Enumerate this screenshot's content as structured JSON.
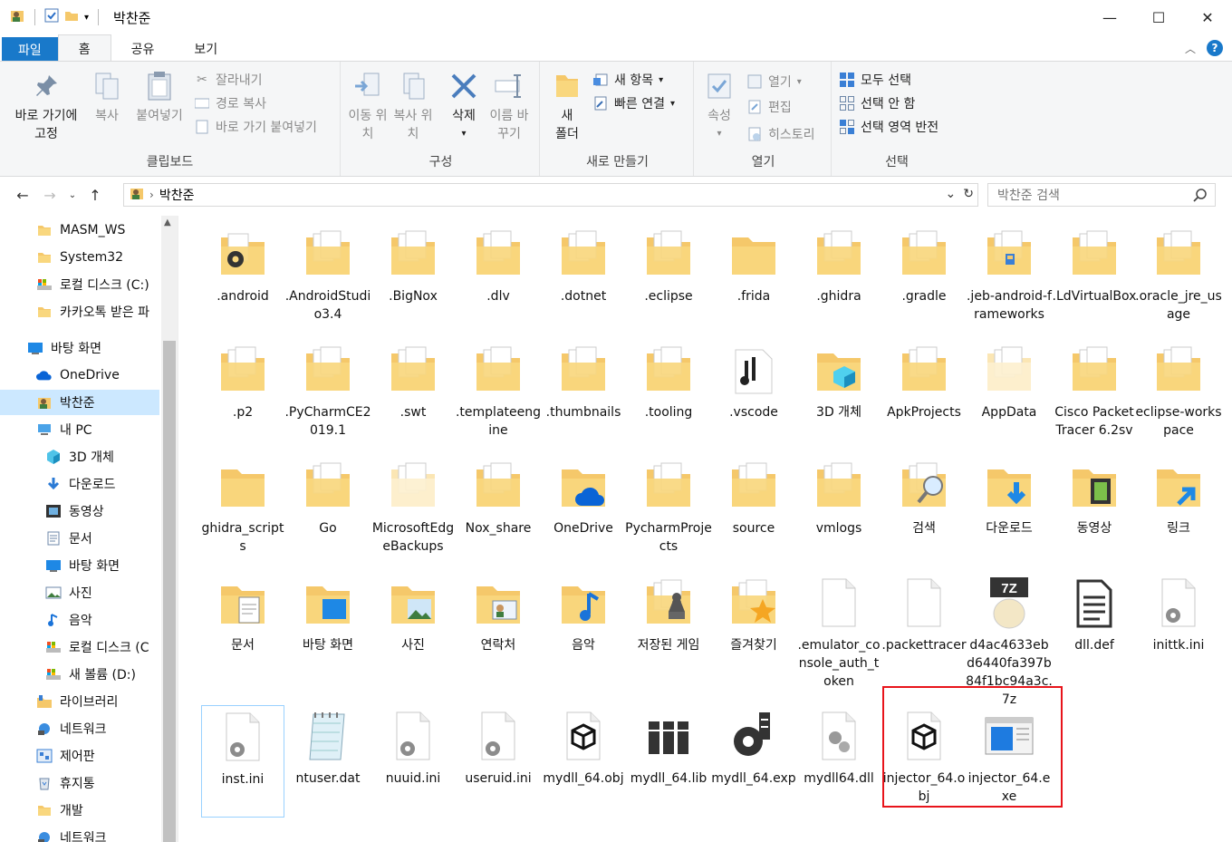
{
  "window": {
    "title": "박찬준"
  },
  "ribbon_tabs": [
    "파일",
    "홈",
    "공유",
    "보기"
  ],
  "ribbon": {
    "clipboard": {
      "label": "클립보드",
      "pin": "바로 가기에 고정",
      "copy": "복사",
      "paste": "붙여넣기",
      "cut": "잘라내기",
      "copy_path": "경로 복사",
      "paste_shortcut": "바로 가기 붙여넣기"
    },
    "organize": {
      "label": "구성",
      "move_to": "이동 위치",
      "copy_to": "복사 위치",
      "delete": "삭제",
      "rename": "이름 바꾸기"
    },
    "new": {
      "label": "새로 만들기",
      "new_folder": "새 폴더",
      "new_item": "새 항목",
      "easy_access": "빠른 연결"
    },
    "open": {
      "label": "열기",
      "properties": "속성",
      "open": "열기",
      "edit": "편집",
      "history": "히스토리"
    },
    "select": {
      "label": "선택",
      "select_all": "모두 선택",
      "select_none": "선택 안 함",
      "invert": "선택 영역 반전"
    }
  },
  "address": {
    "path": "박찬준",
    "search_placeholder": "박찬준 검색"
  },
  "nav_items": [
    {
      "label": "MASM_WS",
      "icon": "folder-icon"
    },
    {
      "label": "System32",
      "icon": "folder-icon"
    },
    {
      "label": "로컬 디스크 (C:)",
      "icon": "drive-icon"
    },
    {
      "label": "카카오톡 받은 파",
      "icon": "folder-icon"
    },
    {
      "label": "바탕 화면",
      "icon": "desktop-icon"
    },
    {
      "label": "OneDrive",
      "icon": "cloud-icon"
    },
    {
      "label": "박찬준",
      "icon": "user-icon"
    },
    {
      "label": "내 PC",
      "icon": "pc-icon"
    },
    {
      "label": "3D 개체",
      "icon": "cube-icon"
    },
    {
      "label": "다운로드",
      "icon": "download-icon"
    },
    {
      "label": "동영상",
      "icon": "video-icon"
    },
    {
      "label": "문서",
      "icon": "document-icon"
    },
    {
      "label": "바탕 화면",
      "icon": "desktop-icon"
    },
    {
      "label": "사진",
      "icon": "picture-icon"
    },
    {
      "label": "음악",
      "icon": "music-icon"
    },
    {
      "label": "로컬 디스크 (C",
      "icon": "drive-icon"
    },
    {
      "label": "새 볼륨 (D:)",
      "icon": "drive-icon"
    },
    {
      "label": "라이브러리",
      "icon": "library-icon"
    },
    {
      "label": "네트워크",
      "icon": "network-icon"
    },
    {
      "label": "제어판",
      "icon": "control-panel-icon"
    },
    {
      "label": "휴지통",
      "icon": "recycle-bin-icon"
    },
    {
      "label": "개발",
      "icon": "folder-icon"
    },
    {
      "label": "네트워크",
      "icon": "network-icon"
    }
  ],
  "files": [
    {
      "name": ".android",
      "icon": "folder-gear"
    },
    {
      "name": ".AndroidStudio3.4",
      "icon": "folder-docs"
    },
    {
      "name": ".BigNox",
      "icon": "folder-docs"
    },
    {
      "name": ".dlv",
      "icon": "folder-docs"
    },
    {
      "name": ".dotnet",
      "icon": "folder-docs"
    },
    {
      "name": ".eclipse",
      "icon": "folder-docs"
    },
    {
      "name": ".frida",
      "icon": "folder"
    },
    {
      "name": ".ghidra",
      "icon": "folder-docs"
    },
    {
      "name": ".gradle",
      "icon": "folder-docs"
    },
    {
      "name": ".jeb-android-frameworks",
      "icon": "folder-apk"
    },
    {
      "name": ".LdVirtualBox",
      "icon": "folder-docs"
    },
    {
      "name": ".oracle_jre_usage",
      "icon": "folder-docs"
    },
    {
      "name": ".p2",
      "icon": "folder-docs"
    },
    {
      "name": ".PyCharmCE2019.1",
      "icon": "folder-docs"
    },
    {
      "name": ".swt",
      "icon": "folder-docs"
    },
    {
      "name": ".templateengine",
      "icon": "folder-docs"
    },
    {
      "name": ".thumbnails",
      "icon": "folder-docs"
    },
    {
      "name": ".tooling",
      "icon": "folder-docs"
    },
    {
      "name": ".vscode",
      "icon": "folder-vscode"
    },
    {
      "name": "3D 개체",
      "icon": "folder-3d"
    },
    {
      "name": "ApkProjects",
      "icon": "folder-docs"
    },
    {
      "name": "AppData",
      "icon": "folder-faded"
    },
    {
      "name": "Cisco Packet Tracer 6.2sv",
      "icon": "folder-docs"
    },
    {
      "name": "eclipse-workspace",
      "icon": "folder-docs"
    },
    {
      "name": "ghidra_scripts",
      "icon": "folder"
    },
    {
      "name": "Go",
      "icon": "folder-docs"
    },
    {
      "name": "MicrosoftEdgeBackups",
      "icon": "folder-faded"
    },
    {
      "name": "Nox_share",
      "icon": "folder-docs"
    },
    {
      "name": "OneDrive",
      "icon": "folder-onedrive"
    },
    {
      "name": "PycharmProjects",
      "icon": "folder-docs"
    },
    {
      "name": "source",
      "icon": "folder-docs"
    },
    {
      "name": "vmlogs",
      "icon": "folder-docs"
    },
    {
      "name": "검색",
      "icon": "folder-search"
    },
    {
      "name": "다운로드",
      "icon": "folder-download"
    },
    {
      "name": "동영상",
      "icon": "folder-video"
    },
    {
      "name": "링크",
      "icon": "folder-link"
    },
    {
      "name": "문서",
      "icon": "folder-document"
    },
    {
      "name": "바탕 화면",
      "icon": "folder-desktop"
    },
    {
      "name": "사진",
      "icon": "folder-picture"
    },
    {
      "name": "연락처",
      "icon": "folder-contact"
    },
    {
      "name": "음악",
      "icon": "folder-music"
    },
    {
      "name": "저장된 게임",
      "icon": "folder-games"
    },
    {
      "name": "즐겨찾기",
      "icon": "folder-star"
    },
    {
      "name": ".emulator_console_auth_token",
      "icon": "file-blank"
    },
    {
      "name": ".packettracer",
      "icon": "file-blank"
    },
    {
      "name": "d4ac4633ebd6440fa397b84f1bc94a3c.7z",
      "icon": "file-7z"
    },
    {
      "name": "dll.def",
      "icon": "file-text"
    },
    {
      "name": "inittk.ini",
      "icon": "file-ini"
    },
    {
      "name": "inst.ini",
      "icon": "file-ini"
    },
    {
      "name": "ntuser.dat",
      "icon": "file-notepad"
    },
    {
      "name": "nuuid.ini",
      "icon": "file-ini"
    },
    {
      "name": "useruid.ini",
      "icon": "file-ini"
    },
    {
      "name": "mydll_64.obj",
      "icon": "file-obj"
    },
    {
      "name": "mydll_64.lib",
      "icon": "file-lib"
    },
    {
      "name": "mydll_64.exp",
      "icon": "file-exp"
    },
    {
      "name": "mydll64.dll",
      "icon": "file-dll"
    },
    {
      "name": "injector_64.obj",
      "icon": "file-obj"
    },
    {
      "name": "injector_64.exe",
      "icon": "file-exe"
    }
  ],
  "colors": {
    "accent": "#1979ca",
    "selection": "#cce8ff",
    "highlight_box": "#e8141b",
    "folder": "#f5c86a"
  }
}
